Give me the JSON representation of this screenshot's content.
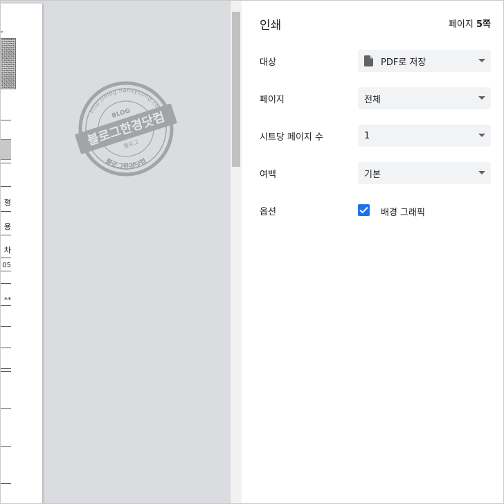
{
  "preview": {
    "sheet_fragments": [
      "형",
      "용",
      "차",
      "05",
      "**"
    ],
    "watermark": {
      "main_text": "블로그한경닷컴",
      "top_ring": "http://blog.hankyeong.com",
      "sub_top": "BLOG",
      "sub_mid": "블로그",
      "bottom_ring": "블로그한경닷컴"
    }
  },
  "settings": {
    "title": "인쇄",
    "page_count_prefix": "페이지 ",
    "page_count_value": "5쪽",
    "destination": {
      "label": "대상",
      "value": "PDF로 저장",
      "icon": "document-icon"
    },
    "pages": {
      "label": "페이지",
      "value": "전체"
    },
    "pages_per_sheet": {
      "label": "시트당 페이지 수",
      "value": "1"
    },
    "margins": {
      "label": "여백",
      "value": "기본"
    },
    "options": {
      "label": "옵션",
      "background_graphics_label": "배경 그래픽",
      "background_graphics_checked": true
    }
  },
  "colors": {
    "accent": "#1a73e8",
    "preview_bg": "#dadce0",
    "select_bg": "#f1f3f4"
  }
}
